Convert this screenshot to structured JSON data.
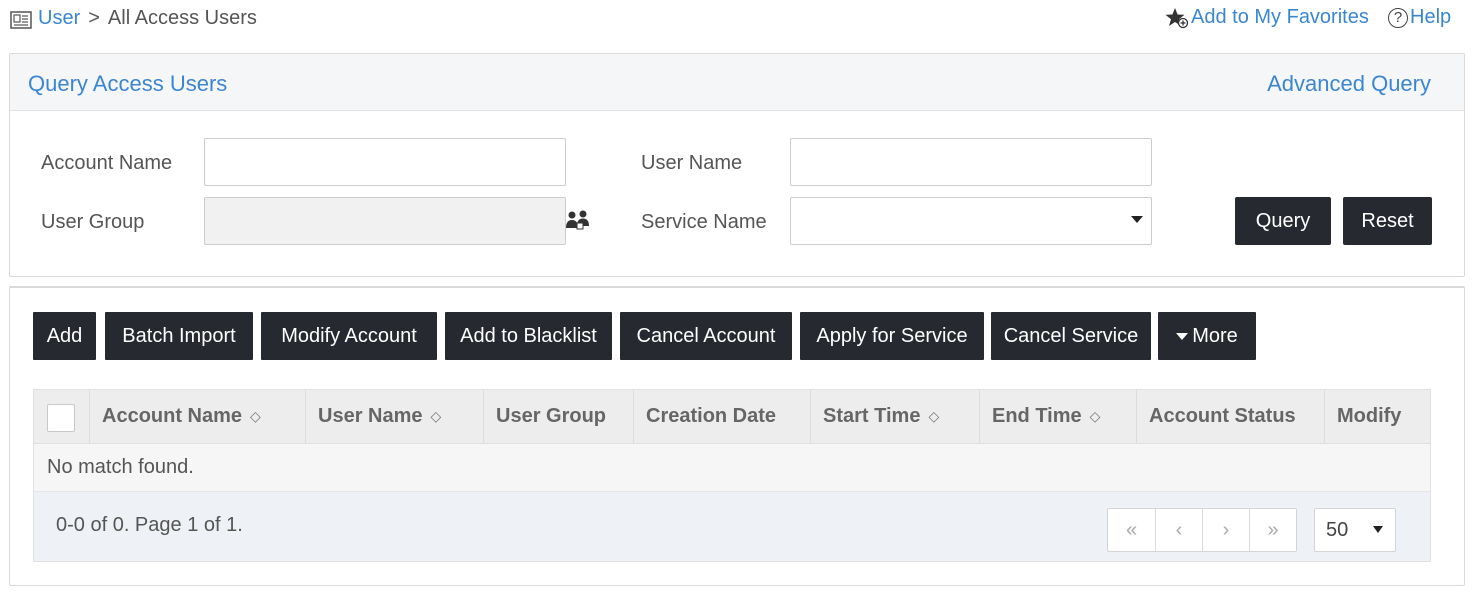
{
  "breadcrumb": {
    "root": "User",
    "separator": ">",
    "current": "All Access Users"
  },
  "header_links": {
    "favorites": "Add to My Favorites",
    "help": "Help"
  },
  "query_panel": {
    "title": "Query Access Users",
    "advanced_query": "Advanced Query",
    "fields": {
      "account_name": {
        "label": "Account Name",
        "value": ""
      },
      "user_name": {
        "label": "User Name",
        "value": ""
      },
      "user_group": {
        "label": "User Group",
        "value": ""
      },
      "service_name": {
        "label": "Service Name",
        "value": ""
      }
    },
    "query_button": "Query",
    "reset_button": "Reset"
  },
  "toolbar": {
    "add": "Add",
    "batch_import": "Batch Import",
    "modify_account": "Modify Account",
    "add_to_blacklist": "Add to Blacklist",
    "cancel_account": "Cancel Account",
    "apply_for_service": "Apply for Service",
    "cancel_service": "Cancel Service",
    "more": "More"
  },
  "table": {
    "columns": [
      "Account Name",
      "User Name",
      "User Group",
      "Creation Date",
      "Start Time",
      "End Time",
      "Account Status",
      "Modify"
    ],
    "sort_glyph": "◇",
    "empty_message": "No match found."
  },
  "pagination": {
    "info": "0-0 of 0. Page 1 of 1.",
    "first": "«",
    "prev": "‹",
    "next": "›",
    "last": "»",
    "page_size": "50"
  },
  "colors": {
    "link": "#3b86d1",
    "button_bg": "#26292f",
    "header_bg": "#f5f6f7"
  },
  "icons": {
    "breadcrumb": "user-directory-icon",
    "favorites": "star-add-icon",
    "help": "question-circle-icon",
    "user_group": "user-group-select-icon"
  }
}
